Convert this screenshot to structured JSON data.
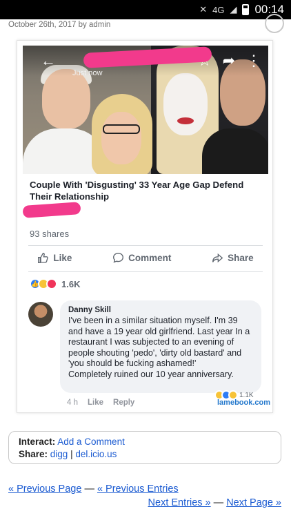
{
  "status_bar": {
    "network": "4G",
    "time": "00:14"
  },
  "dateline": "October 26th, 2017 by admin",
  "post": {
    "timestamp": "Just now",
    "headline": "Couple With 'Disgusting' 33 Year Age Gap Defend Their Relationship",
    "shares": "93 shares",
    "actions": {
      "like": "Like",
      "comment": "Comment",
      "share": "Share"
    },
    "reaction_count": "1.6K"
  },
  "comment": {
    "author": "Danny Skill",
    "text": "I've been in a similar situation  myself. I'm 39 and have a 19 year old girlfriend. Last year In a restaurant I was subjected to an evening of people shouting 'pedo', 'dirty old bastard' and 'you should be fucking ashamed!'\nCompletely ruined our 10 year anniversary.",
    "time": "4 h",
    "like": "Like",
    "reply": "Reply",
    "reaction_count": "1.1K",
    "watermark": "lamebook.com"
  },
  "interact": {
    "interact_label": "Interact:",
    "add_comment": "Add a Comment",
    "share_label": "Share:",
    "digg": "digg",
    "delicious": "del.icio.us",
    "separator": "|"
  },
  "nav": {
    "previous_page": "« Previous Page",
    "dash": "—",
    "previous_entries": "« Previous Entries",
    "next_entries": "Next Entries »",
    "next_page": "Next Page »"
  }
}
